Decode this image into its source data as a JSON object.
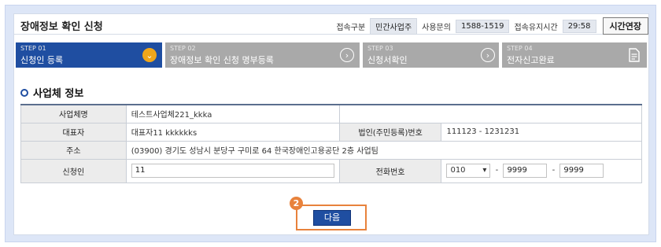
{
  "header": {
    "title": "장애정보 확인 신청",
    "conn_type_label": "접속구분",
    "conn_type_value": "민간사업주",
    "inquiry_label": "사용문의",
    "inquiry_value": "1588-1519",
    "keepalive_label": "접속유지시간",
    "keepalive_value": "29:58",
    "extend_label": "시간연장"
  },
  "steps": [
    {
      "num": "STEP 01",
      "label": "신청인 등록"
    },
    {
      "num": "STEP 02",
      "label": "장애정보 확인 신청 명부등록"
    },
    {
      "num": "STEP 03",
      "label": "신청서확인"
    },
    {
      "num": "STEP 04",
      "label": "전자신고완료"
    }
  ],
  "section": {
    "title": "사업체 정보"
  },
  "table": {
    "company_label": "사업체명",
    "company_value": "테스트사업체221_kkka",
    "ceo_label": "대표자",
    "ceo_value": "대표자11 kkkkkks",
    "corp_no_label": "법인(주민등록)번호",
    "corp_no_value": "111123 - 1231231",
    "address_label": "주소",
    "address_value": "(03900) 경기도 성남시 분당구 구미로 64 한국장애인고용공단 2층 사업팀",
    "applicant_label": "신청인",
    "applicant_value": "11",
    "phone_label": "전화번호",
    "phone_prefix": "010",
    "phone_mid": "9999",
    "phone_last": "9999",
    "dash": "-"
  },
  "footer": {
    "badge": "2",
    "next_label": "다음"
  },
  "colors": {
    "primary": "#1f4ea1",
    "step_inactive": "#a9a9a9",
    "highlight": "#e8823c"
  }
}
